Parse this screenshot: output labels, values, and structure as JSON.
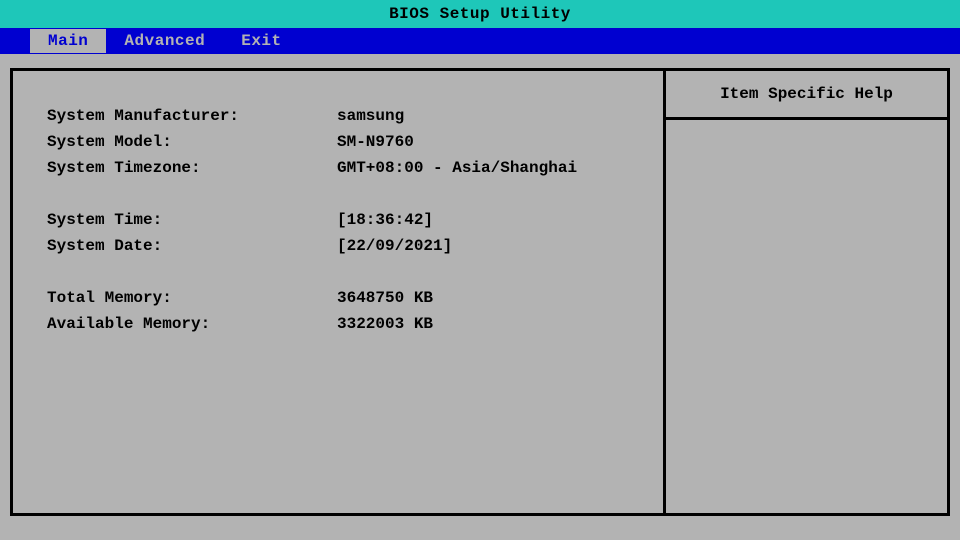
{
  "title": "BIOS Setup Utility",
  "menu": {
    "items": [
      {
        "label": "Main",
        "active": true
      },
      {
        "label": "Advanced",
        "active": false
      },
      {
        "label": "Exit",
        "active": false
      }
    ]
  },
  "help": {
    "header": "Item Specific Help"
  },
  "main": {
    "rows": [
      {
        "label": "System Manufacturer:",
        "value": "samsung"
      },
      {
        "label": "System Model:",
        "value": "SM-N9760"
      },
      {
        "label": "System Timezone:",
        "value": "GMT+08:00 - Asia/Shanghai"
      }
    ],
    "rows2": [
      {
        "label": "System Time:",
        "value": "[18:36:42]"
      },
      {
        "label": "System Date:",
        "value": "[22/09/2021]"
      }
    ],
    "rows3": [
      {
        "label": "Total Memory:",
        "value": "3648750 KB"
      },
      {
        "label": "Available Memory:",
        "value": "3322003 KB"
      }
    ]
  }
}
